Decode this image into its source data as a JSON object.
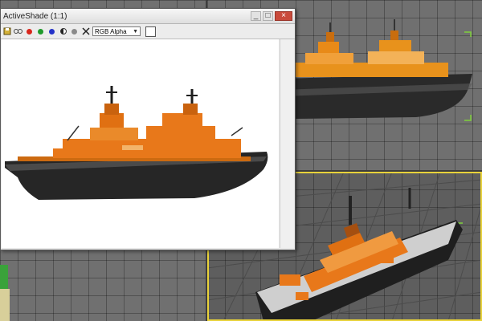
{
  "app": {
    "activeshade_title": "ActiveShade (1:1)",
    "window_controls": {
      "minimize": "_",
      "maximize": "□",
      "close": "×"
    }
  },
  "toolbar": {
    "channel_select": "RGB Alpha",
    "icons": [
      "save-icon",
      "clone-icon",
      "red-channel-icon",
      "green-channel-icon",
      "blue-channel-icon",
      "monochrome-icon",
      "alpha-channel-icon",
      "clear-icon",
      "color-swatch"
    ]
  },
  "colors": {
    "hull": "#2a2a2a",
    "superstructure": "#e87a12",
    "viewport_bg": "#707070",
    "grid_line": "#5a5a5a",
    "selection_bracket": "#7fd13b",
    "active_viewport_border": "#e8d23a",
    "red_channel": "#d9261c",
    "green_channel": "#1f9a2b",
    "blue_channel": "#2432c8"
  },
  "viewports": [
    {
      "name": "top-left",
      "content": "grid"
    },
    {
      "name": "top-right",
      "content": "ship-side-view"
    },
    {
      "name": "bottom-left",
      "content": "grid"
    },
    {
      "name": "bottom-right",
      "content": "ship-perspective-view",
      "active": true
    }
  ]
}
